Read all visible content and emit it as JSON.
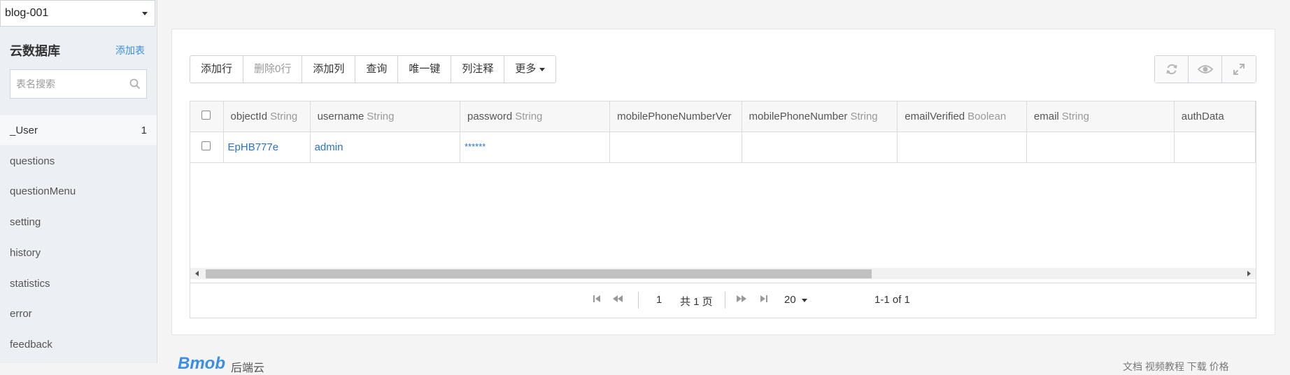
{
  "database": {
    "selected": "blog-001"
  },
  "sidebar": {
    "title": "云数据库",
    "add_table": "添加表",
    "search_placeholder": "表名搜索",
    "tables": [
      {
        "name": "_User",
        "count": "1"
      },
      {
        "name": "questions"
      },
      {
        "name": "questionMenu"
      },
      {
        "name": "setting"
      },
      {
        "name": "history"
      },
      {
        "name": "statistics"
      },
      {
        "name": "error"
      },
      {
        "name": "feedback"
      }
    ]
  },
  "toolbar": {
    "add_row": "添加行",
    "delete_rows": "删除0行",
    "add_column": "添加列",
    "query": "查询",
    "unique_key": "唯一键",
    "column_comment": "列注释",
    "more": "更多"
  },
  "table": {
    "columns": [
      {
        "name": "objectId",
        "type": "String"
      },
      {
        "name": "username",
        "type": "String"
      },
      {
        "name": "password",
        "type": "String"
      },
      {
        "name": "mobilePhoneNumberVer",
        "type": ""
      },
      {
        "name": "mobilePhoneNumber",
        "type": "String"
      },
      {
        "name": "emailVerified",
        "type": "Boolean"
      },
      {
        "name": "email",
        "type": "String"
      },
      {
        "name": "authData",
        "type": ""
      }
    ],
    "rows": [
      {
        "objectId": "EpHB777e",
        "username": "admin",
        "password": "******"
      }
    ]
  },
  "pager": {
    "page": "1",
    "total_pages": "共 1 页",
    "page_size": "20",
    "range": "1-1 of 1"
  },
  "footer": {
    "logo": "Bmob",
    "subtitle": "后端云",
    "links": "文档  视频教程  下载  价格"
  },
  "colors": {
    "accent": "#3a8ee6",
    "link": "#2a72c8"
  }
}
